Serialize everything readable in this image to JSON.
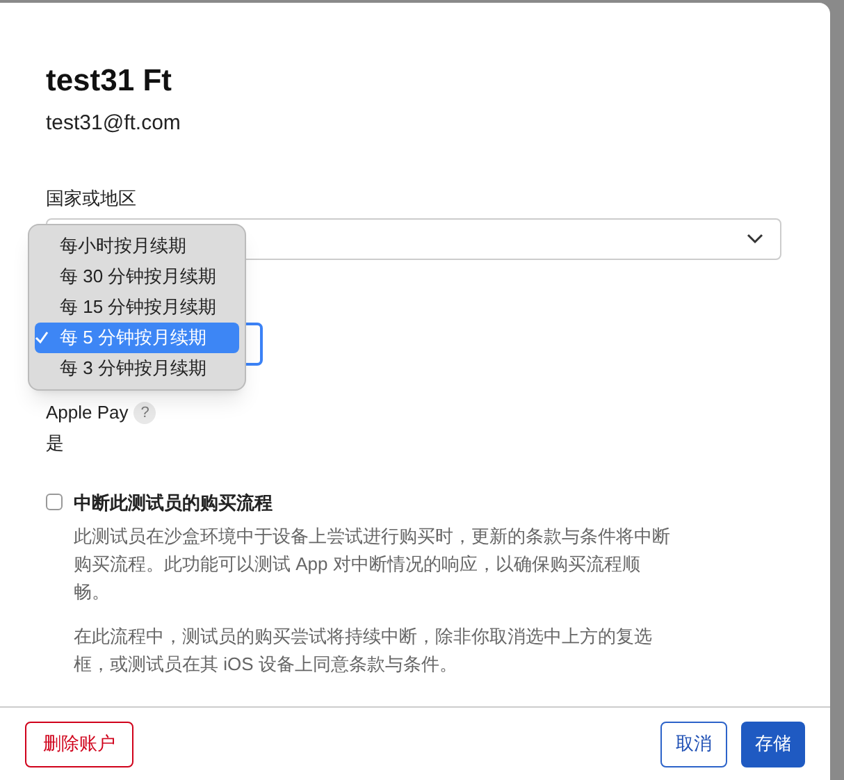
{
  "dialog": {
    "name": "test31 Ft",
    "email": "test31@ft.com"
  },
  "country_field": {
    "label": "国家或地区"
  },
  "renewal_menu": {
    "options": [
      {
        "label": "每小时按月续期",
        "selected": false
      },
      {
        "label": "每 30 分钟按月续期",
        "selected": false
      },
      {
        "label": "每 15 分钟按月续期",
        "selected": false
      },
      {
        "label": "每 5 分钟按月续期",
        "selected": true
      },
      {
        "label": "每 3 分钟按月续期",
        "selected": false
      }
    ]
  },
  "apple_pay": {
    "label": "Apple Pay",
    "help": "?",
    "value": "是"
  },
  "interrupt": {
    "label": "中断此测试员的购买流程",
    "checked": false,
    "paragraphs": [
      "此测试员在沙盒环境中于设备上尝试进行购买时，更新的条款与条件将中断购买流程。此功能可以测试 App 对中断情况的响应，以确保购买流程顺畅。",
      "在此流程中，测试员的购买尝试将持续中断，除非你取消选中上方的复选框，或测试员在其 iOS 设备上同意条款与条件。"
    ]
  },
  "footer": {
    "delete": "删除账户",
    "cancel": "取消",
    "save": "存储"
  }
}
